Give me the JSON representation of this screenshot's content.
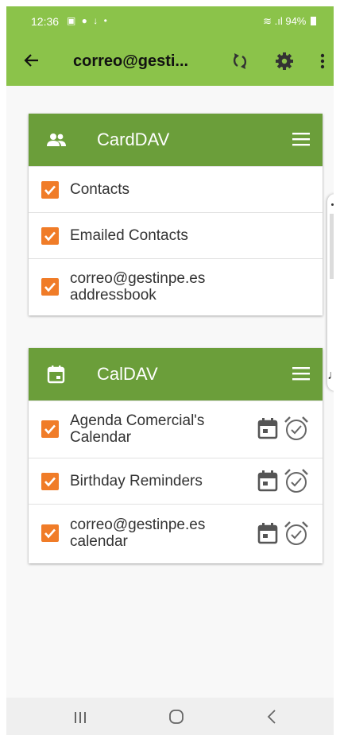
{
  "status_bar": {
    "time": "12:36",
    "battery": "94%"
  },
  "app_bar": {
    "title": "correo@gesti..."
  },
  "carddav": {
    "title": "CardDAV",
    "items": [
      {
        "label": "Contacts"
      },
      {
        "label": "Emailed Contacts"
      },
      {
        "line1": "correo@gestinpe.es",
        "line2": "addressbook"
      }
    ]
  },
  "caldav": {
    "title": "CalDAV",
    "items": [
      {
        "line1": "Agenda Comercial's",
        "line2": "Calendar"
      },
      {
        "label": "Birthday Reminders"
      },
      {
        "line1": "correo@gestinpe.es",
        "line2": "calendar"
      }
    ]
  },
  "colors": {
    "status_bar": "#8bc34a",
    "card_header": "#6b9e3a",
    "checkbox": "#f07c28"
  }
}
